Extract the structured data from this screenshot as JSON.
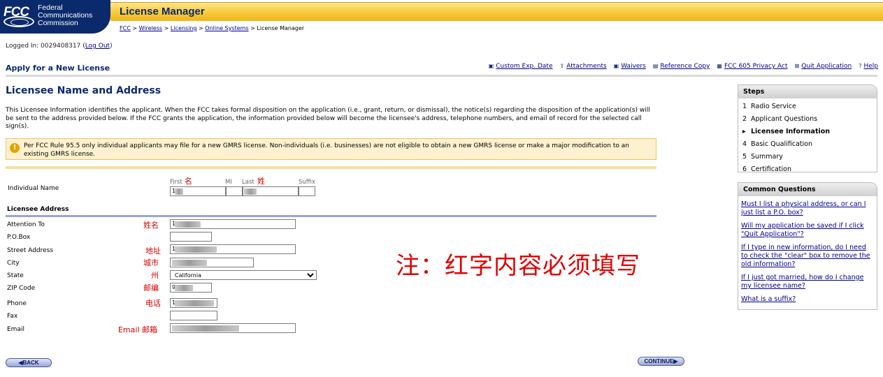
{
  "header": {
    "logo_fcc": "FCC",
    "logo_line1": "Federal",
    "logo_line2": "Communications",
    "logo_line3": "Commission",
    "app_title": "License Manager",
    "breadcrumb": [
      {
        "label": "FCC",
        "link": true
      },
      {
        "label": "Wireless",
        "link": true
      },
      {
        "label": "Licensing",
        "link": true
      },
      {
        "label": "Online Systems",
        "link": true
      },
      {
        "label": "License Manager",
        "link": false
      }
    ],
    "breadcrumb_sep": " > "
  },
  "session": {
    "logged_in_prefix": "Logged In: 0029408317 (",
    "logout_label": "Log Out",
    "logged_in_suffix": ")"
  },
  "section": {
    "title": "Apply for a New License",
    "links": [
      {
        "icon": "calendar-icon",
        "glyph": "▣",
        "label": "Custom Exp. Date"
      },
      {
        "icon": "upload-icon",
        "glyph": "⇪",
        "label": "Attachments"
      },
      {
        "icon": "waiver-icon",
        "glyph": "▣",
        "label": "Waivers"
      },
      {
        "icon": "reference-copy-icon",
        "glyph": "▤",
        "label": "Reference Copy"
      },
      {
        "icon": "privacy-icon",
        "glyph": "▦",
        "label": "FCC 605 Privacy Act"
      },
      {
        "icon": "quit-icon",
        "glyph": "⊠",
        "label": "Quit Application"
      },
      {
        "icon": "help-icon",
        "glyph": "?",
        "label": "Help"
      }
    ]
  },
  "main": {
    "page_title": "Licensee Name and Address",
    "intro": "This Licensee Information identifies the applicant. When the FCC takes formal disposition on the application (i.e., grant, return, or dismissal), the notice(s) regarding the disposition of the application(s) will be sent to the address provided below. If the FCC grants the application, the information provided below will become the licensee's address, telephone numbers, and email of record for the selected call sign(s).",
    "notice": "Per FCC Rule 95.5 only individual applicants may file for a new GMRS license. Non-individuals (i.e. businesses) are not eligible to obtain a new GMRS license or make a major modification to an existing GMRS license.",
    "notice_icon": "!",
    "individual_name": {
      "label": "Individual Name",
      "first_label": "First",
      "first_note": "名",
      "first_value": "1",
      "mi_label": "MI",
      "last_label": "Last",
      "last_note": "姓",
      "suffix_label": "Suffix"
    },
    "address_heading": "Licensee Address",
    "fields": {
      "attention": {
        "label": "Attention To",
        "note": "姓名",
        "value": "1"
      },
      "po_box": {
        "label": "P.O.Box",
        "note": "",
        "value": ""
      },
      "street": {
        "label": "Street Address",
        "note": "地址",
        "value": "1"
      },
      "city": {
        "label": "City",
        "note": "城市",
        "value": ""
      },
      "state": {
        "label": "State",
        "note": "州",
        "value": "California"
      },
      "zip": {
        "label": "ZIP Code",
        "note": "邮编",
        "value": "9"
      },
      "phone": {
        "label": "Phone",
        "note": "电话",
        "value": "1"
      },
      "fax": {
        "label": "Fax",
        "note": "",
        "value": ""
      },
      "email": {
        "label": "Email",
        "note": "Email 邮箱",
        "value": ""
      }
    },
    "annotation": "注：红字内容必须填写"
  },
  "sidebar": {
    "steps_title": "Steps",
    "steps": [
      {
        "num": "1",
        "label": "Radio Service",
        "current": false,
        "marker": ""
      },
      {
        "num": "2",
        "label": "Applicant Questions",
        "current": false,
        "marker": ""
      },
      {
        "num": "▸",
        "label": "Licensee Information",
        "current": true,
        "marker": "▸"
      },
      {
        "num": "4",
        "label": "Basic Qualification",
        "current": false,
        "marker": ""
      },
      {
        "num": "5",
        "label": "Summary",
        "current": false,
        "marker": ""
      },
      {
        "num": "6",
        "label": "Certification",
        "current": false,
        "marker": ""
      }
    ],
    "cq_title": "Common Questions",
    "questions": [
      "Must I list a physical address, or can I just list a P.O. box?",
      "Will my application be saved if I click \"Quit Application\"?",
      "If I type in new information, do I need to check the \"clear\" box to remove the old information?",
      "If I just got married, how do I change my licensee name?",
      "What is a suffix?"
    ]
  },
  "buttons": {
    "back": "BACK",
    "continue": "CONTINUE"
  },
  "colors": {
    "fcc_navy": "#0a2a6c",
    "title_bar_gold": "#f7c93a",
    "required_red": "#d00000",
    "notice_bg": "#fdf1cf"
  }
}
